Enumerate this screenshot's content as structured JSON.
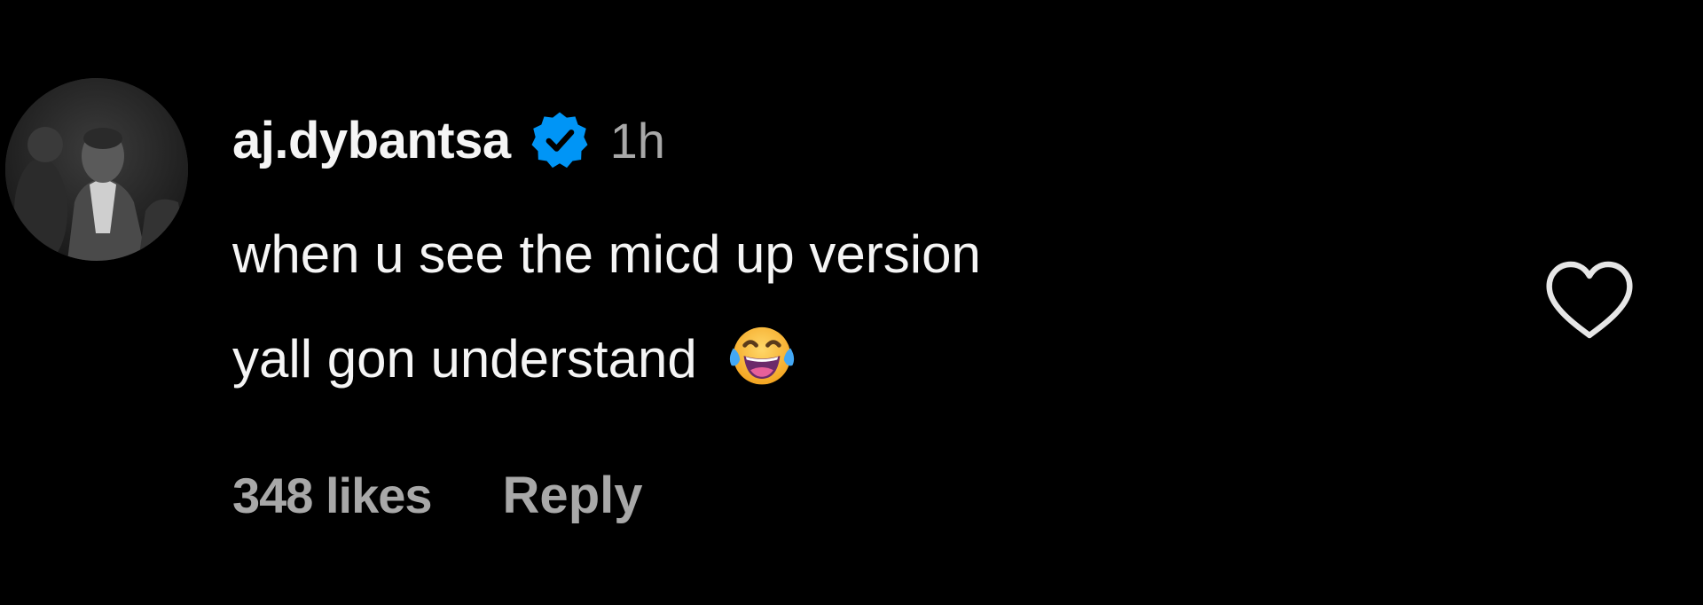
{
  "comment": {
    "username": "aj.dybantsa",
    "verified": true,
    "timestamp": "1h",
    "text_lines": [
      "when u see the micd up version",
      "yall gon understand"
    ],
    "emoji": "face-with-tears-of-joy",
    "likes_label": "348 likes",
    "reply_label": "Reply",
    "liked": false
  },
  "icons": {
    "verified": "verified-badge-icon",
    "like": "heart-outline-icon"
  },
  "colors": {
    "background": "#000000",
    "primary_text": "#f5f5f5",
    "secondary_text": "#a8a8a8",
    "verified_blue": "#0095f6"
  }
}
